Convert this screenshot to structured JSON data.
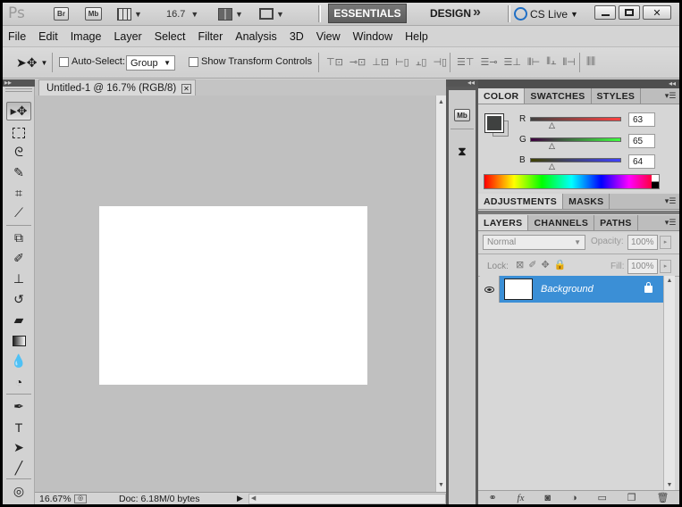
{
  "appbar": {
    "logo": "Ps",
    "bridge": "Br",
    "minibridge": "Mb",
    "zoom": "16.7",
    "essentials": "ESSENTIALS",
    "design": "DESIGN",
    "more": "»",
    "cslive": "CS Live",
    "window_controls": [
      "minimize-icon",
      "maximize-icon",
      "close-icon"
    ]
  },
  "menu": [
    "File",
    "Edit",
    "Image",
    "Layer",
    "Select",
    "Filter",
    "Analysis",
    "3D",
    "View",
    "Window",
    "Help"
  ],
  "options": {
    "auto_select_label": "Auto-Select:",
    "auto_select_value": "Group",
    "show_transform_label": "Show Transform Controls"
  },
  "tools": [
    "move-tool-icon",
    "marquee-tool-icon",
    "lasso-tool-icon",
    "quick-select-tool-icon",
    "crop-tool-icon",
    "eyedropper-tool-icon",
    "healing-brush-tool-icon",
    "brush-tool-icon",
    "clone-stamp-tool-icon",
    "history-brush-tool-icon",
    "eraser-tool-icon",
    "gradient-tool-icon",
    "blur-tool-icon",
    "dodge-tool-icon",
    "pen-tool-icon",
    "type-tool-icon",
    "path-select-tool-icon",
    "line-tool-icon",
    "3d-rotate-tool-icon"
  ],
  "document": {
    "tab_title": "Untitled-1 @ 16.7% (RGB/8)",
    "status_zoom": "16.67%",
    "status_doc": "Doc: 6.18M/0 bytes"
  },
  "color_panel": {
    "tabs": [
      "COLOR",
      "SWATCHES",
      "STYLES"
    ],
    "channels": [
      {
        "label": "R",
        "value": "63"
      },
      {
        "label": "G",
        "value": "65"
      },
      {
        "label": "B",
        "value": "64"
      }
    ],
    "foreground": "#3f4140"
  },
  "adjust_panel": {
    "tabs": [
      "ADJUSTMENTS",
      "MASKS"
    ]
  },
  "layers_panel": {
    "tabs": [
      "LAYERS",
      "CHANNELS",
      "PATHS"
    ],
    "blend_mode": "Normal",
    "opacity_label": "Opacity:",
    "opacity_value": "100%",
    "lock_label": "Lock:",
    "fill_label": "Fill:",
    "fill_value": "100%",
    "layers": [
      {
        "name": "Background",
        "selected": true
      }
    ]
  }
}
